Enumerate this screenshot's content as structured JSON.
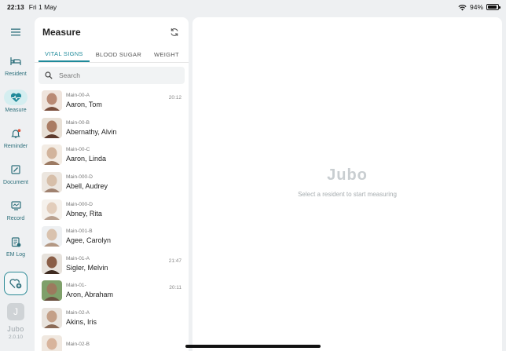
{
  "status": {
    "time": "22:13",
    "date": "Fri 1 May",
    "battery": "94%",
    "battery_level": 0.94
  },
  "rail": {
    "items": [
      {
        "label": "Resident",
        "icon": "bed-icon"
      },
      {
        "label": "Measure",
        "icon": "heart-pulse-icon",
        "active": true
      },
      {
        "label": "Reminder",
        "icon": "bell-icon"
      },
      {
        "label": "Document",
        "icon": "document-edit-icon"
      },
      {
        "label": "Record",
        "icon": "monitor-icon"
      },
      {
        "label": "EM Log",
        "icon": "em-log-icon"
      }
    ],
    "avatar_initial": "J",
    "logo": "Jubo",
    "version": "2.0.10"
  },
  "panel": {
    "title": "Measure",
    "tabs": [
      "VITAL SIGNS",
      "BLOOD SUGAR",
      "WEIGHT"
    ],
    "active_tab": 0,
    "search_placeholder": "Search"
  },
  "residents": [
    {
      "unit": "Main-00-A",
      "name": "Aaron, Tom",
      "time": "20:12"
    },
    {
      "unit": "Main-00-B",
      "name": "Abernathy, Alvin",
      "time": ""
    },
    {
      "unit": "Main-00-C",
      "name": "Aaron, Linda",
      "time": ""
    },
    {
      "unit": "Main-000-D",
      "name": "Abell, Audrey",
      "time": ""
    },
    {
      "unit": "Main-000-D",
      "name": "Abney, Rita",
      "time": ""
    },
    {
      "unit": "Main-001-B",
      "name": "Agee, Carolyn",
      "time": ""
    },
    {
      "unit": "Main-01-A",
      "name": "Sigler, Melvin",
      "time": "21:47"
    },
    {
      "unit": "Main-01-",
      "name": "Aron, Abraham",
      "time": "20:11"
    },
    {
      "unit": "Main-02-A",
      "name": "Akins, Iris",
      "time": ""
    },
    {
      "unit": "Main-02-B",
      "name": "",
      "time": ""
    }
  ],
  "detail": {
    "logo": "Jubo",
    "empty_message": "Select a resident to start measuring"
  },
  "colors": {
    "accent": "#1f8a9a",
    "rail_active_bg": "#d4eef0"
  }
}
